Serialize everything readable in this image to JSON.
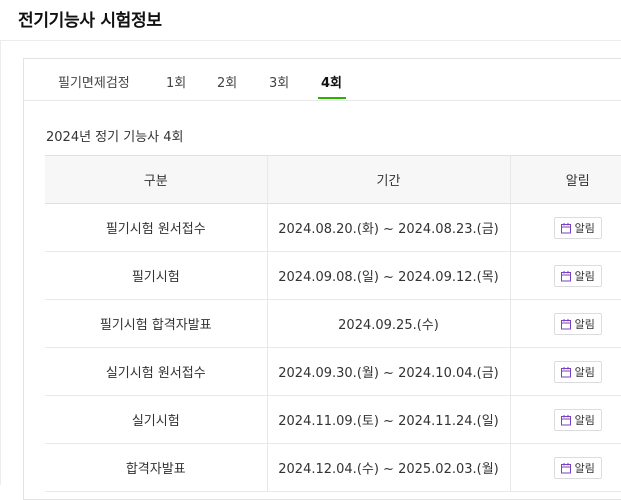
{
  "page": {
    "title": "전기기능사 시험정보"
  },
  "tabs": [
    {
      "label": "필기면제검정",
      "active": false
    },
    {
      "label": "1회",
      "active": false
    },
    {
      "label": "2회",
      "active": false
    },
    {
      "label": "3회",
      "active": false
    },
    {
      "label": "4회",
      "active": true
    }
  ],
  "schedule": {
    "heading": "2024년 정기 기능사 4회",
    "columns": [
      "구분",
      "기간",
      "알림"
    ],
    "alert_label": "알림",
    "rows": [
      {
        "category": "필기시험 원서접수",
        "period": "2024.08.20.(화) ~ 2024.08.23.(금)"
      },
      {
        "category": "필기시험",
        "period": "2024.09.08.(일) ~ 2024.09.12.(목)"
      },
      {
        "category": "필기시험 합격자발표",
        "period": "2024.09.25.(수)"
      },
      {
        "category": "실기시험 원서접수",
        "period": "2024.09.30.(월) ~ 2024.10.04.(금)"
      },
      {
        "category": "실기시험",
        "period": "2024.11.09.(토) ~ 2024.11.24.(일)"
      },
      {
        "category": "합격자발표",
        "period": "2024.12.04.(수) ~ 2025.02.03.(월)"
      }
    ]
  },
  "colors": {
    "active_tab_underline": "#2db400",
    "calendar_icon": "#7b3fbf",
    "header_bg": "#f7f7f8"
  },
  "icons": {
    "alert": "calendar-icon"
  }
}
